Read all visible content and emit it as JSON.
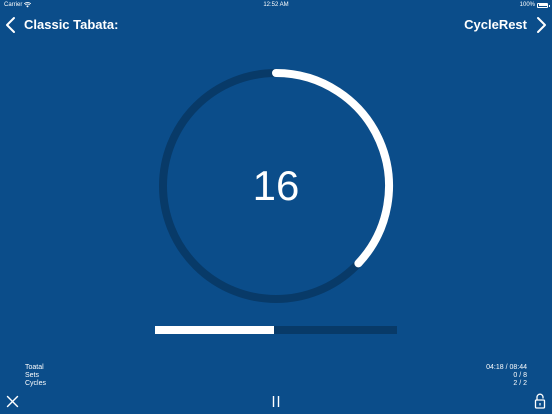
{
  "status_bar": {
    "carrier": "Carrier",
    "time": "12:52 AM",
    "battery": "100%",
    "wifi_icon": "wifi-icon",
    "battery_icon": "battery-full-icon"
  },
  "nav": {
    "title": "Classic Tabata:",
    "right_title": "CycleRest",
    "back_icon": "chevron-left-icon",
    "forward_icon": "chevron-right-icon"
  },
  "timer": {
    "countdown": "16",
    "ring_progress": 0.37
  },
  "overall_progress": 0.49,
  "stats": {
    "labels": [
      "Toatal",
      "Sets",
      "Cycles"
    ],
    "values": [
      "04:18 / 08:44",
      "0 / 8",
      "2 / 2"
    ]
  },
  "toolbar": {
    "close_icon": "close-icon",
    "pause_icon": "pause-icon",
    "lock_icon": "unlock-icon"
  },
  "colors": {
    "background": "#0b4d8a",
    "track": "#083a68",
    "foreground": "#ffffff"
  }
}
